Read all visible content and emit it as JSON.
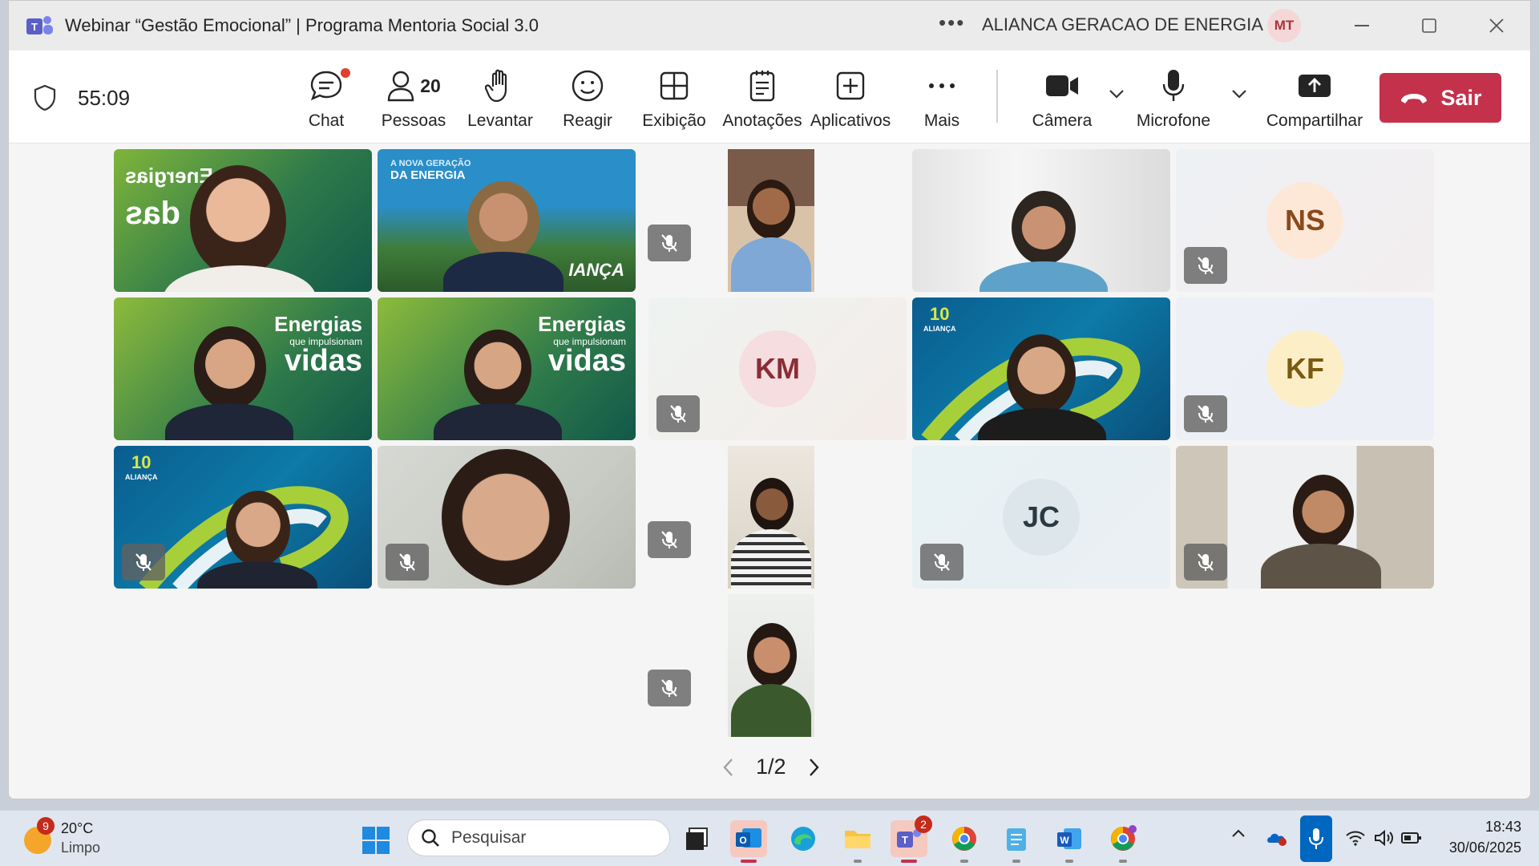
{
  "window": {
    "title": "Webinar “Gestão Emocional” | Programa Mentoria Social 3.0",
    "more_label": "•••",
    "org_name": "ALIANCA GERACAO DE ENERGIA",
    "user_initials": "MT"
  },
  "meeting": {
    "elapsed": "55:09",
    "people_count": "20",
    "toolbar": {
      "chat": "Chat",
      "people": "Pessoas",
      "raise": "Levantar",
      "react": "Reagir",
      "view": "Exibição",
      "notes": "Anotações",
      "apps": "Aplicativos",
      "more": "Mais",
      "camera": "Câmera",
      "microphone": "Microfone",
      "share": "Compartilhar",
      "leave": "Sair"
    },
    "participants": {
      "ns": "NS",
      "km": "KM",
      "kf": "KF",
      "jc": "JC"
    },
    "backgrounds": {
      "energias": "Energias",
      "que": "que impulsionam",
      "vidas": "vidas",
      "nova_geracao": "A NOVA GERAÇÃO",
      "da_energia": "DA ENERGIA",
      "alianca": "ALIANÇA",
      "ten": "10",
      "mirror_energias": "Energias",
      "mirror_das": "das",
      "ianca": "IANÇA"
    },
    "pager": "1/2"
  },
  "taskbar": {
    "weather_temp": "20°C",
    "weather_cond": "Limpo",
    "weather_badge": "9",
    "search_placeholder": "Pesquisar",
    "teams_badge": "2",
    "time": "18:43",
    "date": "30/06/2025"
  },
  "colors": {
    "leave": "#c4314b",
    "accent_blue": "#0067c0",
    "teams_purple": "#5b5fc7"
  }
}
